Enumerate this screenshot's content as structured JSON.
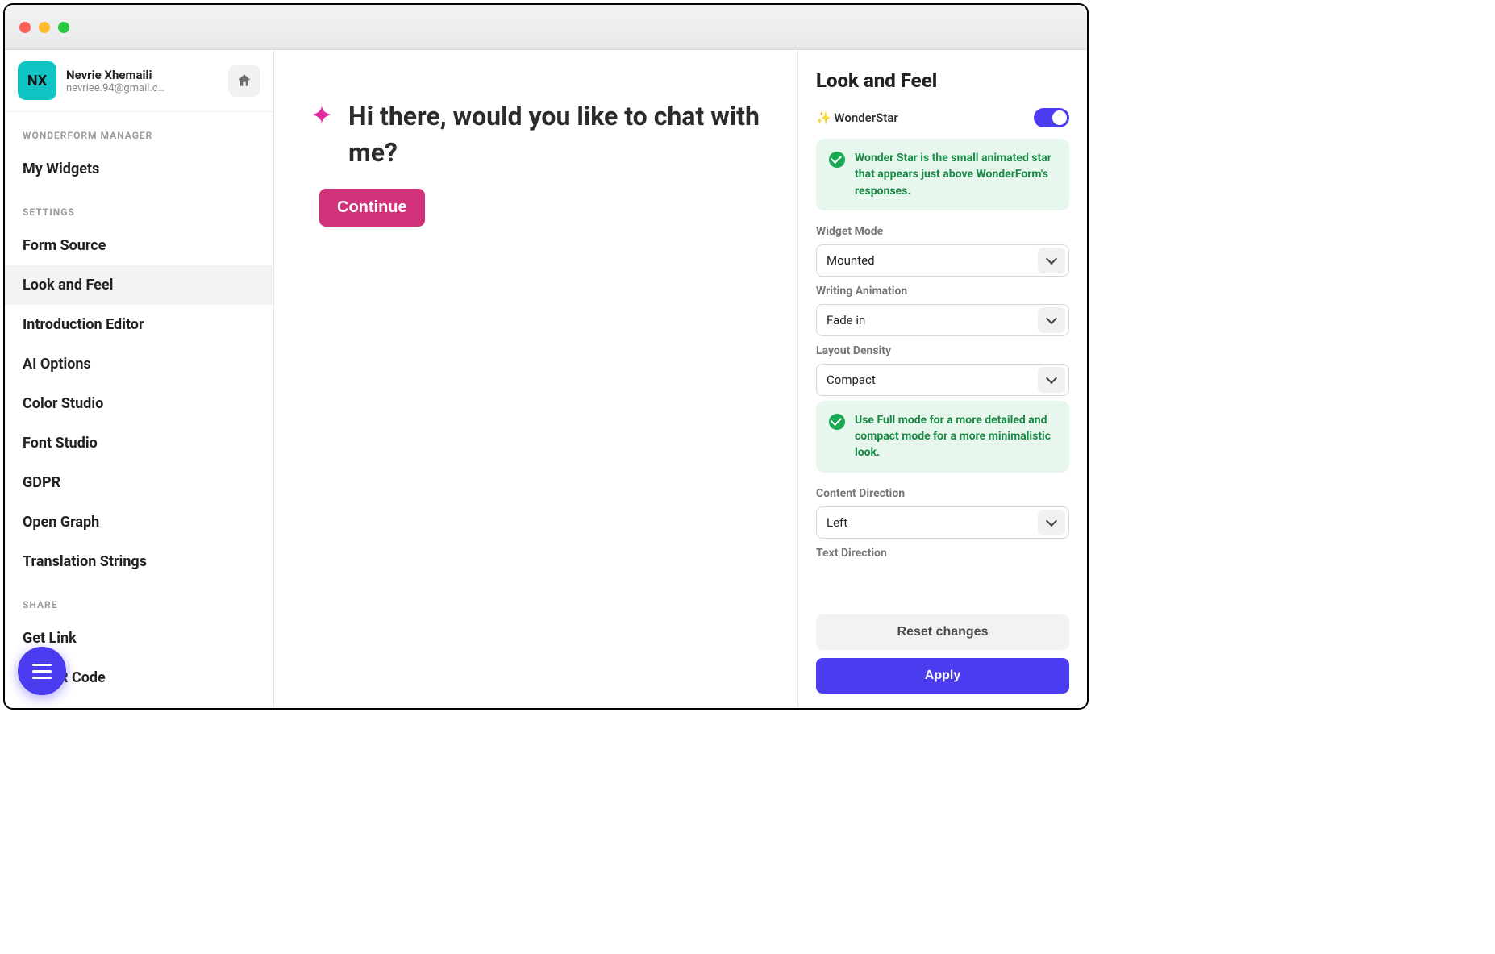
{
  "user": {
    "initials": "NX",
    "name": "Nevrie Xhemaili",
    "email": "nevriee.94@gmail.c…"
  },
  "sidebar": {
    "sections": [
      {
        "title": "WONDERFORM MANAGER",
        "items": [
          "My Widgets"
        ]
      },
      {
        "title": "SETTINGS",
        "items": [
          "Form Source",
          "Look and Feel",
          "Introduction Editor",
          "AI Options",
          "Color Studio",
          "Font Studio",
          "GDPR",
          "Open Graph",
          "Translation Strings"
        ]
      },
      {
        "title": "SHARE",
        "items": [
          "Get Link",
          "Get QR Code"
        ]
      }
    ],
    "active": "Look and Feel"
  },
  "preview": {
    "greeting": "Hi there, would you like to chat with me?",
    "continue_label": "Continue"
  },
  "panel": {
    "title": "Look and Feel",
    "wonderstar": {
      "label": "✨ WonderStar",
      "enabled": true,
      "info": "Wonder Star is the small animated star that appears just above WonderForm's responses."
    },
    "fields": {
      "widget_mode": {
        "label": "Widget Mode",
        "value": "Mounted"
      },
      "writing_animation": {
        "label": "Writing Animation",
        "value": "Fade in"
      },
      "layout_density": {
        "label": "Layout Density",
        "value": "Compact",
        "info": "Use Full mode for a more detailed and compact mode for a more minimalistic look."
      },
      "content_direction": {
        "label": "Content Direction",
        "value": "Left"
      },
      "text_direction": {
        "label": "Text Direction"
      }
    },
    "buttons": {
      "reset": "Reset changes",
      "apply": "Apply"
    }
  },
  "colors": {
    "accent": "#4b3cf0",
    "pink": "#d1327a",
    "star": "#e12da3"
  }
}
